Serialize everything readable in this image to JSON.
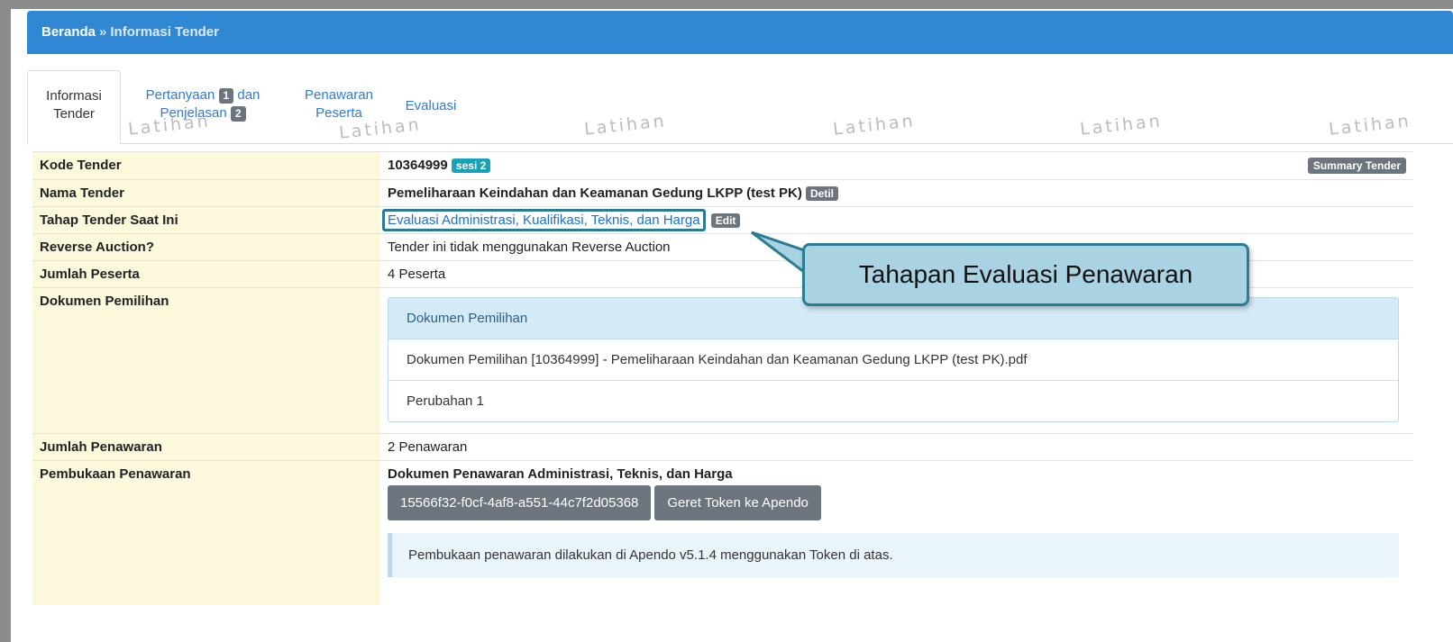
{
  "breadcrumb": {
    "home": "Beranda",
    "separator": "»",
    "current": "Informasi Tender"
  },
  "tabs": [
    {
      "line1": "Informasi",
      "line2": "Tender"
    },
    {
      "line1": "Pertanyaan",
      "badge1": "1",
      "line1b": "dan",
      "line2": "Penjelasan",
      "badge2": "2"
    },
    {
      "line1": "Penawaran",
      "line2": "Peserta"
    },
    {
      "line1": "Evaluasi"
    }
  ],
  "watermark": "Latihan",
  "rows": {
    "kode": {
      "label": "Kode Tender",
      "value": "10364999",
      "sesi": "sesi 2",
      "summary_btn": "Summary Tender"
    },
    "nama": {
      "label": "Nama Tender",
      "value": "Pemeliharaan Keindahan dan Keamanan Gedung LKPP (test PK)",
      "detil_btn": "Detil"
    },
    "tahap": {
      "label": "Tahap Tender Saat Ini",
      "value": "Evaluasi Administrasi, Kualifikasi, Teknis, dan Harga",
      "edit_btn": "Edit"
    },
    "reverse": {
      "label": "Reverse Auction?",
      "value": "Tender ini tidak menggunakan Reverse Auction"
    },
    "peserta": {
      "label": "Jumlah Peserta",
      "value": "4 Peserta"
    },
    "dokumen": {
      "label": "Dokumen Pemilihan",
      "panel_title": "Dokumen Pemilihan",
      "items": [
        "Dokumen Pemilihan [10364999] - Pemeliharaan Keindahan dan Keamanan Gedung LKPP (test PK).pdf",
        "Perubahan 1"
      ]
    },
    "penawaran": {
      "label": "Jumlah Penawaran",
      "value": "2 Penawaran"
    },
    "pembukaan": {
      "label": "Pembukaan Penawaran",
      "title": "Dokumen Penawaran Administrasi, Teknis, dan Harga",
      "token": "15566f32-f0cf-4af8-a551-44c7f2d05368",
      "geret_btn": "Geret Token ke Apendo",
      "info": "Pembukaan penawaran dilakukan di Apendo v5.1.4 menggunakan Token di atas."
    }
  },
  "callout": "Tahapan Evaluasi Penawaran",
  "colors": {
    "header_blue": "#3088d4",
    "label_bg": "#fbf8dc",
    "callout_bg": "#a9d2e2",
    "callout_border": "#2a7c92"
  }
}
